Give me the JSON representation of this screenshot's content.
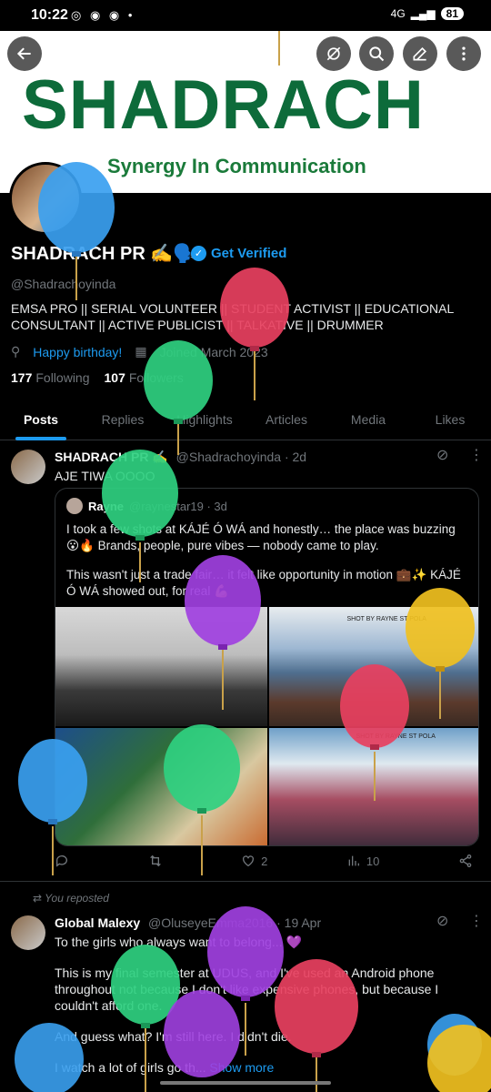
{
  "status": {
    "time": "10:22",
    "signal": "4G",
    "battery": "81"
  },
  "banner": {
    "logo": "SHADRACH",
    "tagline": "Synergy In Communication"
  },
  "profile": {
    "name": "SHADRACH PR ✍️🗣️",
    "verify_label": "Get Verified",
    "handle": "@Shadrachoyinda",
    "bio": "EMSA PRO || SERIAL VOLUNTEER || STUDENT ACTIVIST || EDUCATIONAL CONSULTANT || ACTIVE PUBLICIST || TALKATIVE || DRUMMER",
    "birthday": "Happy birthday!",
    "joined": "Joined March 2023",
    "following_count": "177",
    "following_label": "Following",
    "followers_count": "107",
    "followers_label": "Followers"
  },
  "tabs": [
    "Posts",
    "Replies",
    "Highlights",
    "Articles",
    "Media",
    "Likes"
  ],
  "post1": {
    "author": "SHADRACH PR ✍️",
    "handle_time": "@Shadrachoyinda · 2d",
    "text": "AJE TIWA OOOO",
    "quote": {
      "author": "Rayne",
      "handle_time": "@raynestar19 · 3d",
      "text1": "I took a few shots at KÁJÉ Ó WÁ and honestly… the place was buzzing 😮🔥 Brands, people, pure vibes — nobody came to play.",
      "text2": "This wasn't just a trade fair… it felt like opportunity in motion 💼✨ KÁJÉ Ó WÁ showed out, for real 💪",
      "media_caption_top": "SHOT BY RAYNE ST POLA",
      "media_caption_bottom": "SHOT BY RAYNE ST POLA"
    },
    "likes": "2",
    "views": "10"
  },
  "post2": {
    "repost_label": "You reposted",
    "author": "Global Malexy",
    "handle_time": "@OluseyeEmma2016 · 19 Apr",
    "p1": "To the girls who always want to belong... 💜",
    "p2": "This is my final semester at UDUS, and I've used an Android phone throughout not because I don't like expensive phones, but because I couldn't afford one.",
    "p3": "And guess what? I'm still here. I didn't die.",
    "p4": "I watch a lot of girls go th...",
    "show_more": "Show more"
  },
  "colors": {
    "accent": "#1d9bf0",
    "background": "#000000",
    "muted": "#71767b",
    "brand_green": "#0d6b3a"
  },
  "icons": [
    "back-arrow-icon",
    "grok-icon",
    "search-icon",
    "edit-icon",
    "more-vertical-icon",
    "verified-badge-icon",
    "location-icon",
    "calendar-icon",
    "reply-icon",
    "repost-icon",
    "like-icon",
    "views-icon",
    "share-icon"
  ]
}
